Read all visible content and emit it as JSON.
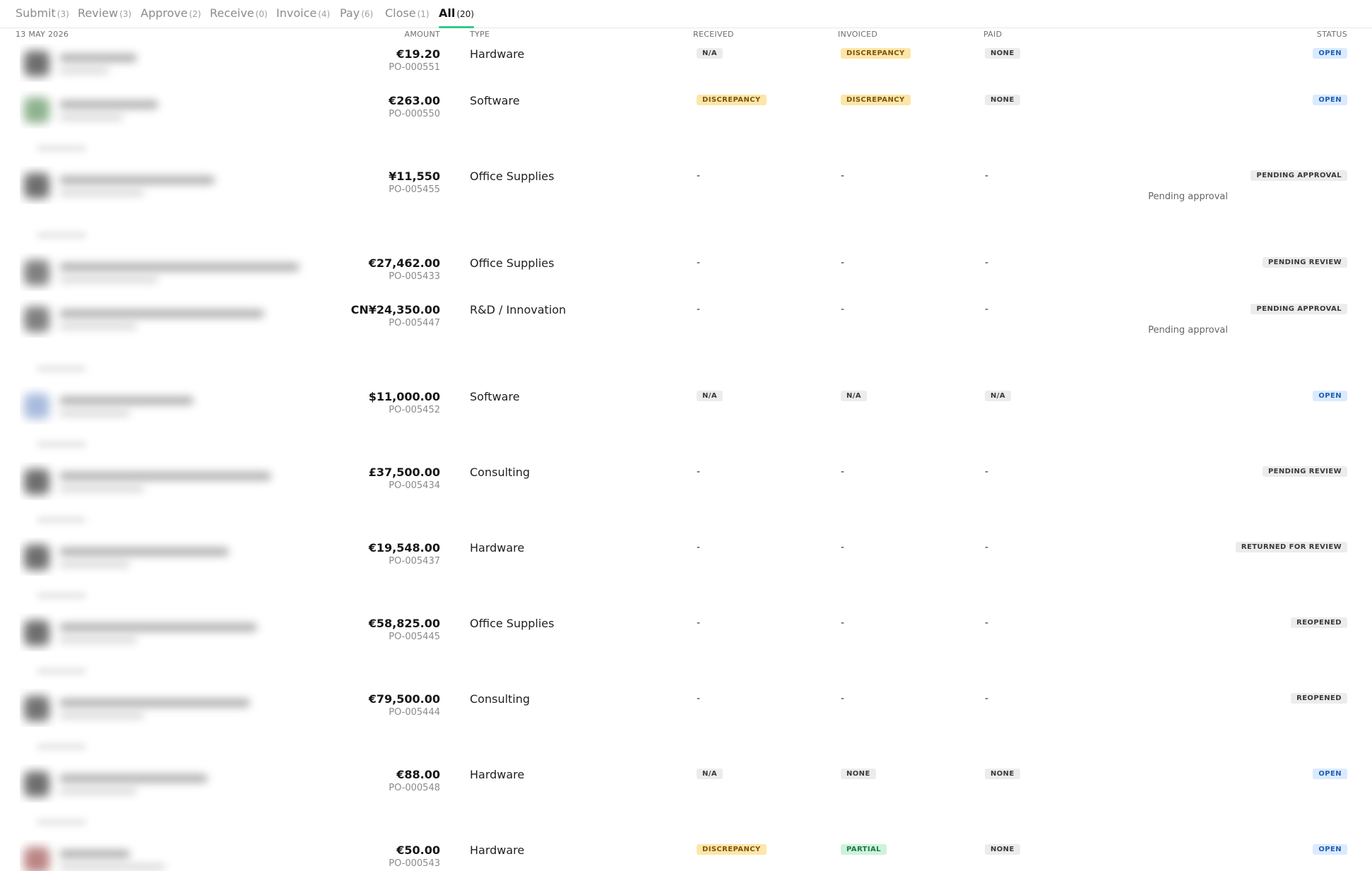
{
  "tabs": [
    {
      "label": "Submit",
      "count": "(3)"
    },
    {
      "label": "Review",
      "count": "(3)"
    },
    {
      "label": "Approve",
      "count": "(2)"
    },
    {
      "label": "Receive",
      "count": "(0)"
    },
    {
      "label": "Invoice",
      "count": "(4)"
    },
    {
      "label": "Pay",
      "count": "(6)"
    },
    {
      "label": "Close",
      "count": "(1)"
    },
    {
      "label": "All",
      "count": "(20)"
    }
  ],
  "header": {
    "date": "13 MAY 2026",
    "amount": "AMOUNT",
    "type": "TYPE",
    "received": "RECEIVED",
    "invoiced": "INVOICED",
    "paid": "PAID",
    "status": "STATUS"
  },
  "colors": {
    "accent": "#34c98a"
  },
  "rows": [
    {
      "amount": "€19.20",
      "po": "PO-000551",
      "type": "Hardware",
      "received": "N/A",
      "invoiced": "DISCREPANCY",
      "paid": "NONE",
      "status": "OPEN",
      "note": ""
    },
    {
      "amount": "€263.00",
      "po": "PO-000550",
      "type": "Software",
      "received": "DISCREPANCY",
      "invoiced": "DISCREPANCY",
      "paid": "NONE",
      "status": "OPEN",
      "note": ""
    },
    {
      "amount": "¥11,550",
      "po": "PO-005455",
      "type": "Office Supplies",
      "received": "-",
      "invoiced": "-",
      "paid": "-",
      "status": "PENDING APPROVAL",
      "note": "Pending approval"
    },
    {
      "amount": "€27,462.00",
      "po": "PO-005433",
      "type": "Office Supplies",
      "received": "-",
      "invoiced": "-",
      "paid": "-",
      "status": "PENDING REVIEW",
      "note": ""
    },
    {
      "amount": "CN¥24,350.00",
      "po": "PO-005447",
      "type": "R&D / Innovation",
      "received": "-",
      "invoiced": "-",
      "paid": "-",
      "status": "PENDING APPROVAL",
      "note": "Pending approval"
    },
    {
      "amount": "$11,000.00",
      "po": "PO-005452",
      "type": "Software",
      "received": "N/A",
      "invoiced": "N/A",
      "paid": "N/A",
      "status": "OPEN",
      "note": ""
    },
    {
      "amount": "£37,500.00",
      "po": "PO-005434",
      "type": "Consulting",
      "received": "-",
      "invoiced": "-",
      "paid": "-",
      "status": "PENDING REVIEW",
      "note": ""
    },
    {
      "amount": "€19,548.00",
      "po": "PO-005437",
      "type": "Hardware",
      "received": "-",
      "invoiced": "-",
      "paid": "-",
      "status": "RETURNED FOR REVIEW",
      "note": ""
    },
    {
      "amount": "€58,825.00",
      "po": "PO-005445",
      "type": "Office Supplies",
      "received": "-",
      "invoiced": "-",
      "paid": "-",
      "status": "REOPENED",
      "note": ""
    },
    {
      "amount": "€79,500.00",
      "po": "PO-005444",
      "type": "Consulting",
      "received": "-",
      "invoiced": "-",
      "paid": "-",
      "status": "REOPENED",
      "note": ""
    },
    {
      "amount": "€88.00",
      "po": "PO-000548",
      "type": "Hardware",
      "received": "N/A",
      "invoiced": "NONE",
      "paid": "NONE",
      "status": "OPEN",
      "note": ""
    },
    {
      "amount": "€50.00",
      "po": "PO-000543",
      "type": "Hardware",
      "received": "DISCREPANCY",
      "invoiced": "PARTIAL",
      "paid": "NONE",
      "status": "OPEN",
      "note": ""
    }
  ]
}
